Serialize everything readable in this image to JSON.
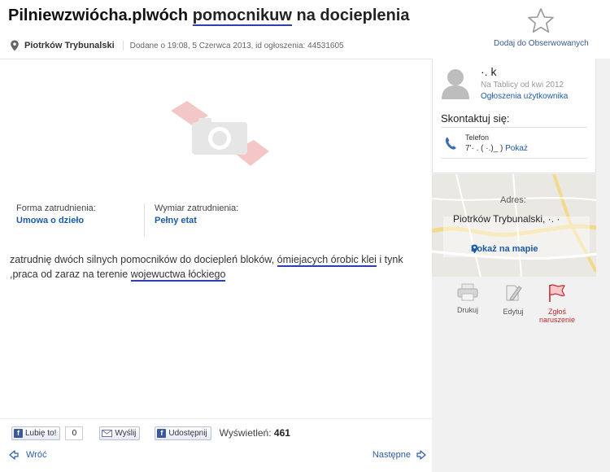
{
  "header": {
    "title_watermark": "Pilniewzwiócha.plwóch",
    "title_underlined": "pomocnikuw",
    "title_rest": "na docieplenia",
    "watch_label": "Dodaj do Obserwowanych"
  },
  "meta": {
    "city": "Piotrków Trybunalski",
    "added": "Dodane o 19:08, 5 Czerwca 2013, id ogłoszenia: 44531605"
  },
  "details": {
    "employment_form_label": "Forma zatrudnienia:",
    "employment_form_value": "Umowa o dzieło",
    "employment_time_label": "Wymiar zatrudnienia:",
    "employment_time_value": "Pełny etat"
  },
  "description": {
    "part1": "zatrudnię dwóch silnych pomocników do dociepleń bloków, ",
    "u1": "ómiejacych órobic klei",
    "part2": " i tynk ,praca od zaraz na terenie ",
    "u2": "wojewuctwa łóckiego"
  },
  "social": {
    "like_label": "Lubię to!",
    "like_count": "0",
    "send_label": "Wyślij",
    "share_label": "Udostępnij",
    "views_label": "Wyświetleń:",
    "views_count": "461"
  },
  "nav": {
    "back_label": "Wróć",
    "next_label": "Następne"
  },
  "sidebar": {
    "user_name": "·.  k",
    "user_since": "Na Tablicy od kwi 2012",
    "user_ads_link": "Ogłoszenia użytkownika",
    "contact_label": "Skontaktuj się:",
    "phone_label": "Telefon",
    "phone_masked": "7'·  .   ( ·.)_ )",
    "phone_show": "Pokaż",
    "address_label": "Adres:",
    "address_value": "Piotrków Trybunalski, ·. ·",
    "map_link": "Pokaż na mapie",
    "tools": {
      "print_label": "Drukuj",
      "edit_label": "Edytuj",
      "report_label_1": "Zgłoś",
      "report_label_2": "naruszenie"
    }
  },
  "colors": {
    "link": "#1d5aa8",
    "underline": "#2f3fb0",
    "report": "#c0282e"
  }
}
